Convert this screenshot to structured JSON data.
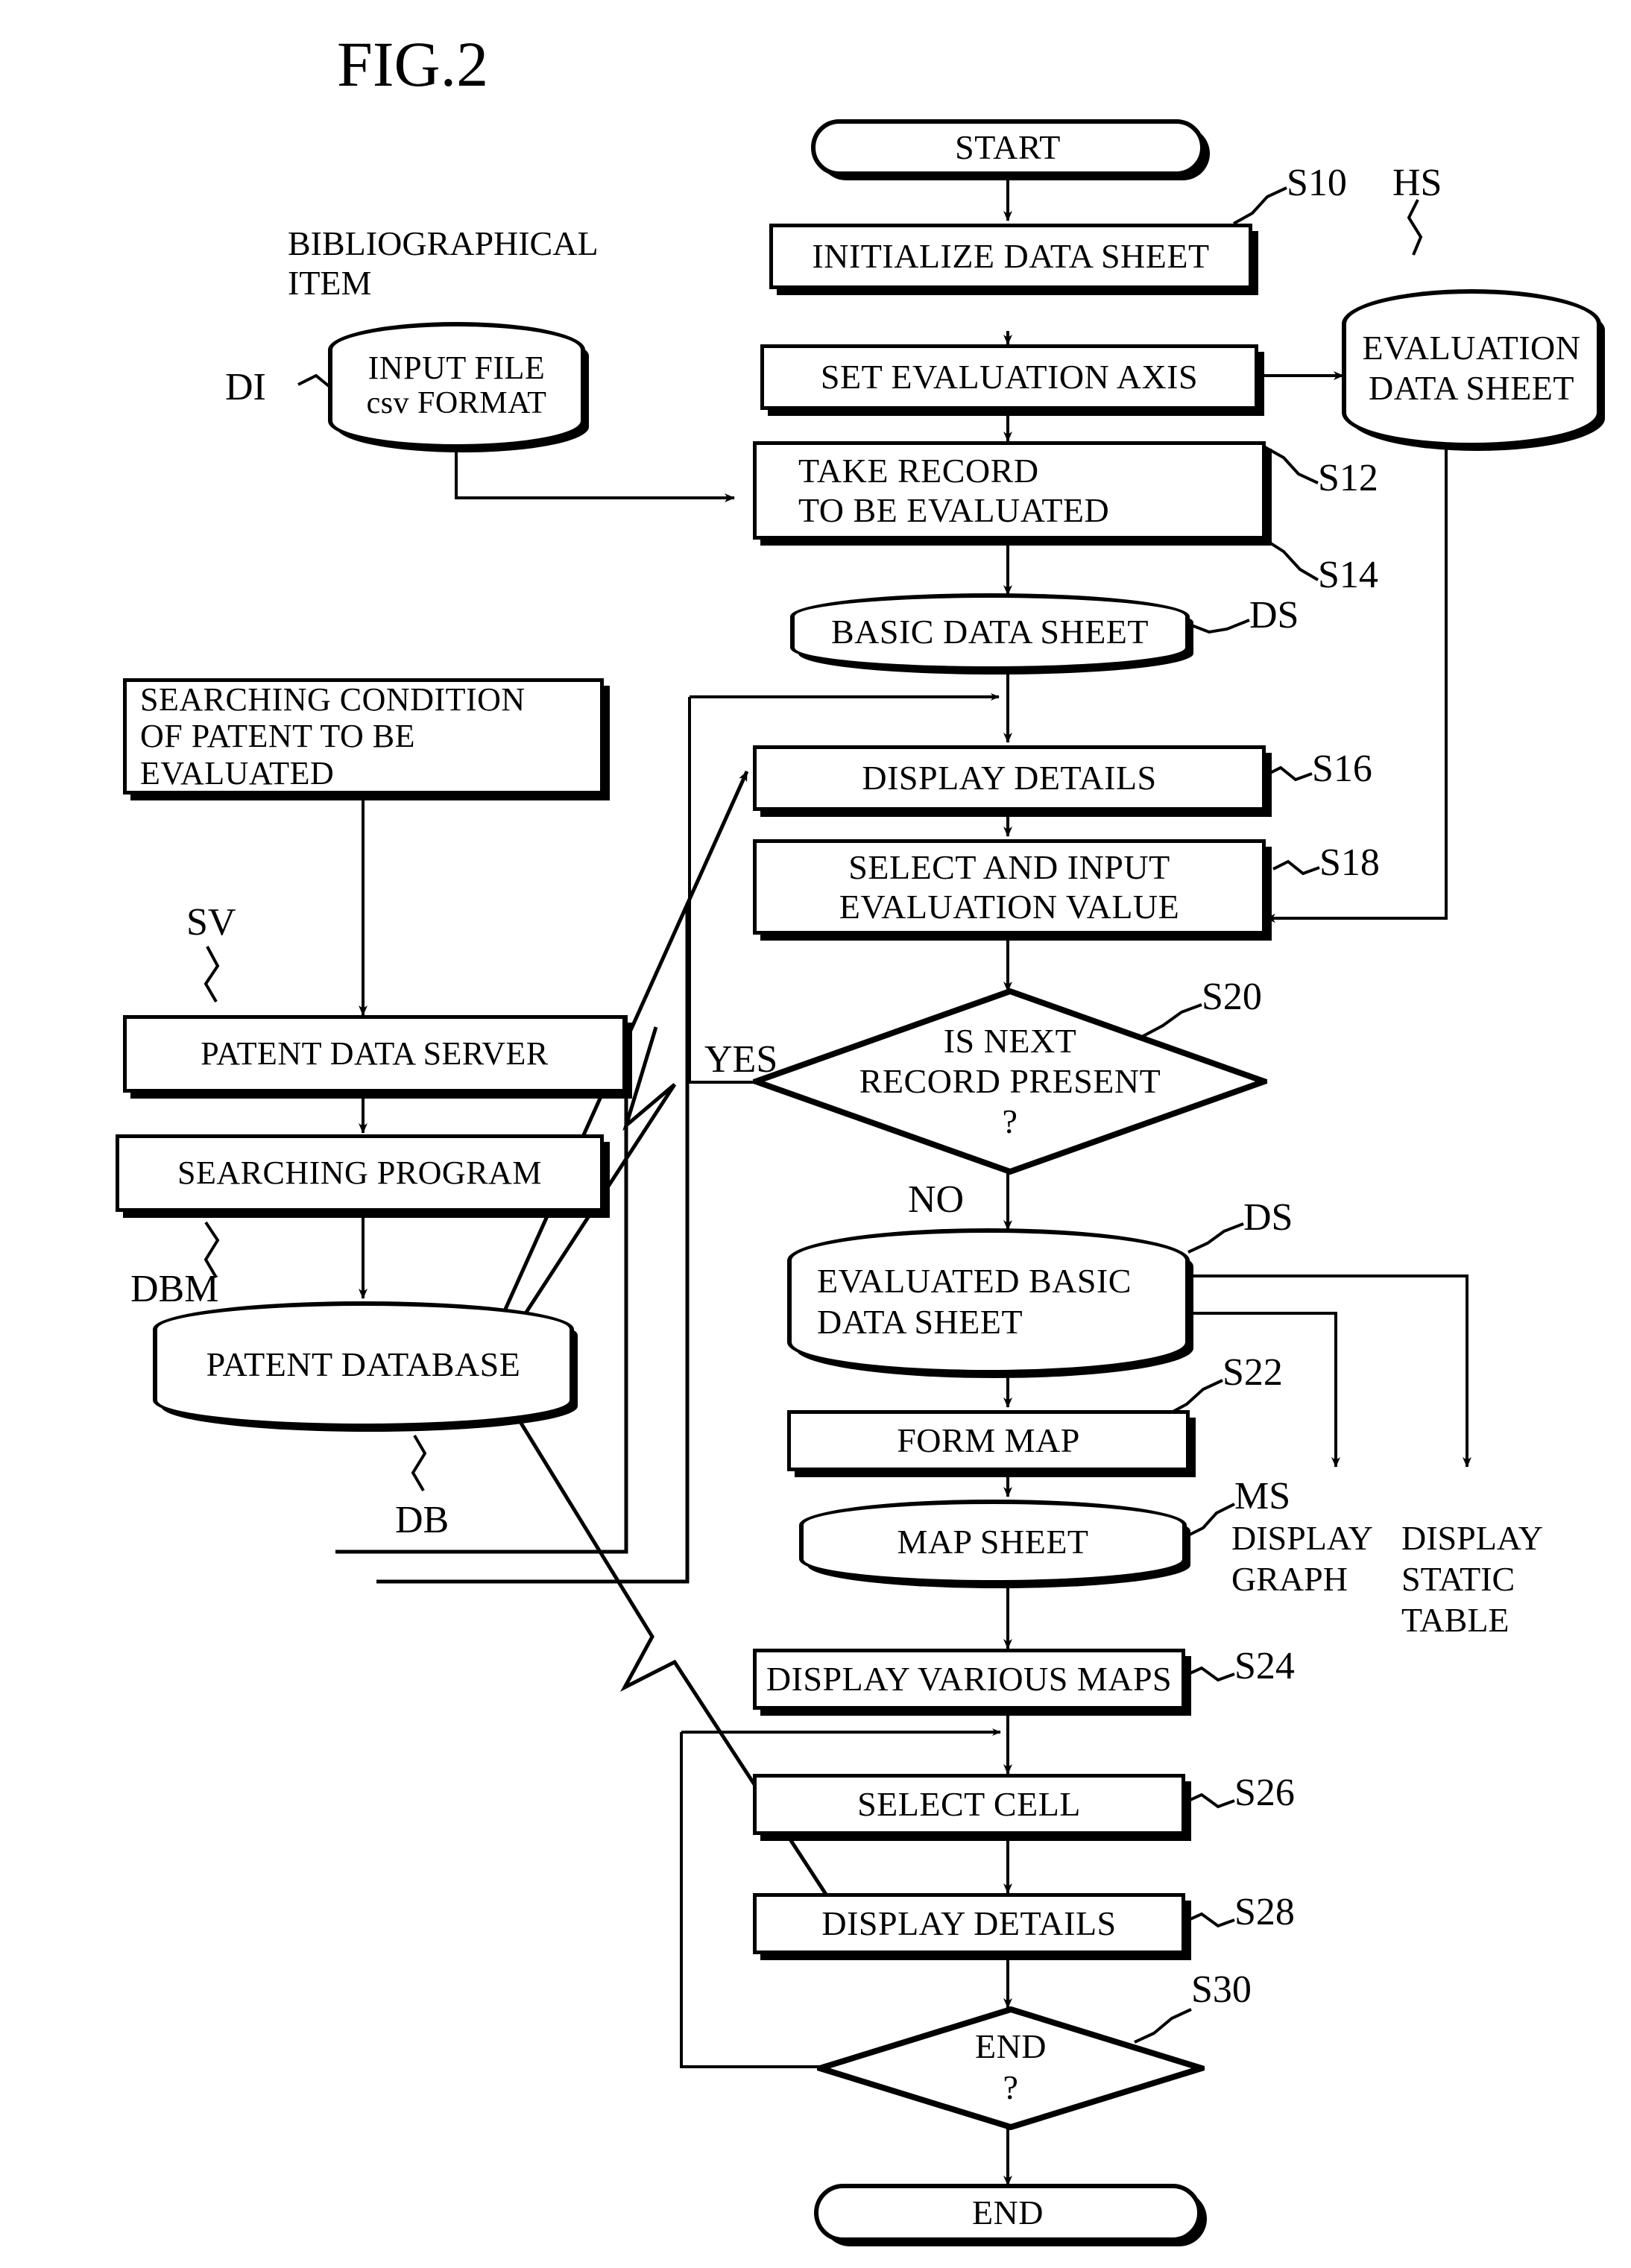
{
  "figure": {
    "title": "FIG.2"
  },
  "left_labels": {
    "bibliographical_item": "BIBLIOGRAPHICAL\nITEM",
    "di": "DI",
    "sv": "SV",
    "dbm": "DBM",
    "db": "DB"
  },
  "right_labels": {
    "hs": "HS",
    "ds_top": "DS",
    "ds_mid": "DS",
    "ms": "MS",
    "display_graph": "DISPLAY\nGRAPH",
    "display_static_table": "DISPLAY\nSTATIC\nTABLE"
  },
  "step_tags": {
    "s10": "S10",
    "s12": "S12",
    "s14": "S14",
    "s16": "S16",
    "s18": "S18",
    "s20": "S20",
    "s22": "S22",
    "s24": "S24",
    "s26": "S26",
    "s28": "S28",
    "s30": "S30"
  },
  "edge_labels": {
    "yes": "YES",
    "no": "NO"
  },
  "nodes": {
    "start": {
      "label": "START",
      "shape": "terminator"
    },
    "initialize_data_sheet": {
      "label": "INITIALIZE DATA SHEET",
      "shape": "process"
    },
    "set_evaluation_axis": {
      "label": "SET EVALUATION AXIS",
      "shape": "process"
    },
    "evaluation_data_sheet": {
      "label": "EVALUATION\nDATA SHEET",
      "shape": "datastore"
    },
    "take_record": {
      "label": "TAKE RECORD\nTO BE EVALUATED",
      "shape": "process"
    },
    "basic_data_sheet": {
      "label": "BASIC DATA SHEET",
      "shape": "datastore"
    },
    "display_details_1": {
      "label": "DISPLAY DETAILS",
      "shape": "process"
    },
    "select_and_input": {
      "label": "SELECT AND INPUT\nEVALUATION VALUE",
      "shape": "process"
    },
    "is_next_record": {
      "label": "IS NEXT\nRECORD PRESENT\n?",
      "shape": "decision"
    },
    "evaluated_basic_data_sheet": {
      "label": "EVALUATED BASIC\nDATA SHEET",
      "shape": "datastore"
    },
    "form_map": {
      "label": "FORM MAP",
      "shape": "process"
    },
    "map_sheet": {
      "label": "MAP SHEET",
      "shape": "datastore"
    },
    "display_various_maps": {
      "label": "DISPLAY VARIOUS MAPS",
      "shape": "process"
    },
    "select_cell": {
      "label": "SELECT CELL",
      "shape": "process"
    },
    "display_details_2": {
      "label": "DISPLAY DETAILS",
      "shape": "process"
    },
    "end_decision": {
      "label": "END\n?",
      "shape": "decision"
    },
    "end": {
      "label": "END",
      "shape": "terminator"
    },
    "input_file": {
      "label": "INPUT FILE",
      "label2": "csv FORMAT",
      "shape": "datastore"
    },
    "searching_condition": {
      "label": "SEARCHING CONDITION\nOF PATENT TO BE\nEVALUATED",
      "shape": "process_plain"
    },
    "patent_data_server": {
      "label": "PATENT DATA SERVER",
      "shape": "process"
    },
    "searching_program": {
      "label": "SEARCHING PROGRAM",
      "shape": "process"
    },
    "patent_database": {
      "label": "PATENT DATABASE",
      "shape": "datastore"
    }
  },
  "colors": {
    "ink": "#000000",
    "paper": "#ffffff"
  }
}
